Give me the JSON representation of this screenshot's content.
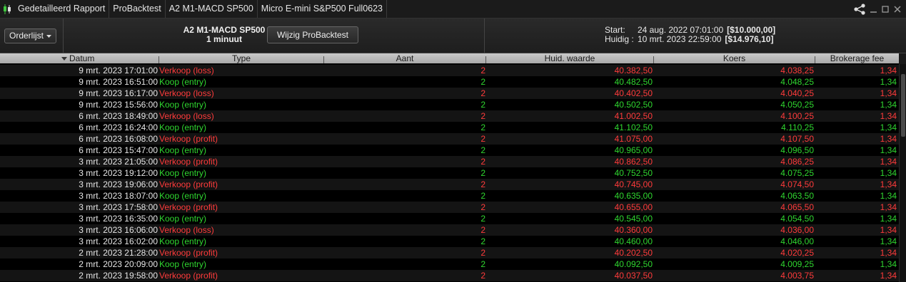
{
  "titlebar": {
    "segments": [
      "Gedetailleerd Rapport",
      "ProBacktest",
      "A2 M1-MACD SP500",
      "Micro E-mini S&P500 Full0623"
    ],
    "icons": [
      "share-icon",
      "minimize-icon",
      "maximize-icon",
      "close-icon"
    ]
  },
  "header": {
    "orderlist_label": "Orderlijst",
    "strategy_name": "A2 M1-MACD SP500",
    "timeframe": "1 minuut",
    "modify_button": "Wijzig ProBacktest",
    "start_label": "Start:",
    "start_date": "24 aug. 2022 07:01:00",
    "start_amount": "[$10.000,00]",
    "current_label": "Huidig :",
    "current_date": "10 mrt. 2023 22:59:00",
    "current_amount": "[$14.976,10]"
  },
  "columns": [
    "Datum",
    "Type",
    "Aant",
    "Huid. waarde",
    "Koers",
    "Brokerage fee"
  ],
  "colors": {
    "loss_red": "#ff3b3b",
    "gain_green": "#2fd62f"
  },
  "rows": [
    {
      "date": "9 mrt. 2023 17:01:00",
      "type": "Verkoop (loss)",
      "qty": "2",
      "value": "40.382,50",
      "price": "4.038,25",
      "fee": "1,34",
      "dir": "red"
    },
    {
      "date": "9 mrt. 2023 16:51:00",
      "type": "Koop (entry)",
      "qty": "2",
      "value": "40.482,50",
      "price": "4.048,25",
      "fee": "1,34",
      "dir": "green"
    },
    {
      "date": "9 mrt. 2023 16:17:00",
      "type": "Verkoop (loss)",
      "qty": "2",
      "value": "40.402,50",
      "price": "4.040,25",
      "fee": "1,34",
      "dir": "red"
    },
    {
      "date": "9 mrt. 2023 15:56:00",
      "type": "Koop (entry)",
      "qty": "2",
      "value": "40.502,50",
      "price": "4.050,25",
      "fee": "1,34",
      "dir": "green"
    },
    {
      "date": "6 mrt. 2023 18:49:00",
      "type": "Verkoop (loss)",
      "qty": "2",
      "value": "41.002,50",
      "price": "4.100,25",
      "fee": "1,34",
      "dir": "red"
    },
    {
      "date": "6 mrt. 2023 16:24:00",
      "type": "Koop (entry)",
      "qty": "2",
      "value": "41.102,50",
      "price": "4.110,25",
      "fee": "1,34",
      "dir": "green"
    },
    {
      "date": "6 mrt. 2023 16:08:00",
      "type": "Verkoop (profit)",
      "qty": "2",
      "value": "41.075,00",
      "price": "4.107,50",
      "fee": "1,34",
      "dir": "red"
    },
    {
      "date": "6 mrt. 2023 15:47:00",
      "type": "Koop (entry)",
      "qty": "2",
      "value": "40.965,00",
      "price": "4.096,50",
      "fee": "1,34",
      "dir": "green"
    },
    {
      "date": "3 mrt. 2023 21:05:00",
      "type": "Verkoop (profit)",
      "qty": "2",
      "value": "40.862,50",
      "price": "4.086,25",
      "fee": "1,34",
      "dir": "red"
    },
    {
      "date": "3 mrt. 2023 19:12:00",
      "type": "Koop (entry)",
      "qty": "2",
      "value": "40.752,50",
      "price": "4.075,25",
      "fee": "1,34",
      "dir": "green"
    },
    {
      "date": "3 mrt. 2023 19:06:00",
      "type": "Verkoop (profit)",
      "qty": "2",
      "value": "40.745,00",
      "price": "4.074,50",
      "fee": "1,34",
      "dir": "red"
    },
    {
      "date": "3 mrt. 2023 18:07:00",
      "type": "Koop (entry)",
      "qty": "2",
      "value": "40.635,00",
      "price": "4.063,50",
      "fee": "1,34",
      "dir": "green"
    },
    {
      "date": "3 mrt. 2023 17:58:00",
      "type": "Verkoop (profit)",
      "qty": "2",
      "value": "40.655,00",
      "price": "4.065,50",
      "fee": "1,34",
      "dir": "red"
    },
    {
      "date": "3 mrt. 2023 16:35:00",
      "type": "Koop (entry)",
      "qty": "2",
      "value": "40.545,00",
      "price": "4.054,50",
      "fee": "1,34",
      "dir": "green"
    },
    {
      "date": "3 mrt. 2023 16:06:00",
      "type": "Verkoop (loss)",
      "qty": "2",
      "value": "40.360,00",
      "price": "4.036,00",
      "fee": "1,34",
      "dir": "red"
    },
    {
      "date": "3 mrt. 2023 16:02:00",
      "type": "Koop (entry)",
      "qty": "2",
      "value": "40.460,00",
      "price": "4.046,00",
      "fee": "1,34",
      "dir": "green"
    },
    {
      "date": "2 mrt. 2023 21:28:00",
      "type": "Verkoop (profit)",
      "qty": "2",
      "value": "40.202,50",
      "price": "4.020,25",
      "fee": "1,34",
      "dir": "red"
    },
    {
      "date": "2 mrt. 2023 20:09:00",
      "type": "Koop (entry)",
      "qty": "2",
      "value": "40.092,50",
      "price": "4.009,25",
      "fee": "1,34",
      "dir": "green"
    },
    {
      "date": "2 mrt. 2023 19:58:00",
      "type": "Verkoop (profit)",
      "qty": "2",
      "value": "40.037,50",
      "price": "4.003,75",
      "fee": "1,34",
      "dir": "red"
    }
  ]
}
